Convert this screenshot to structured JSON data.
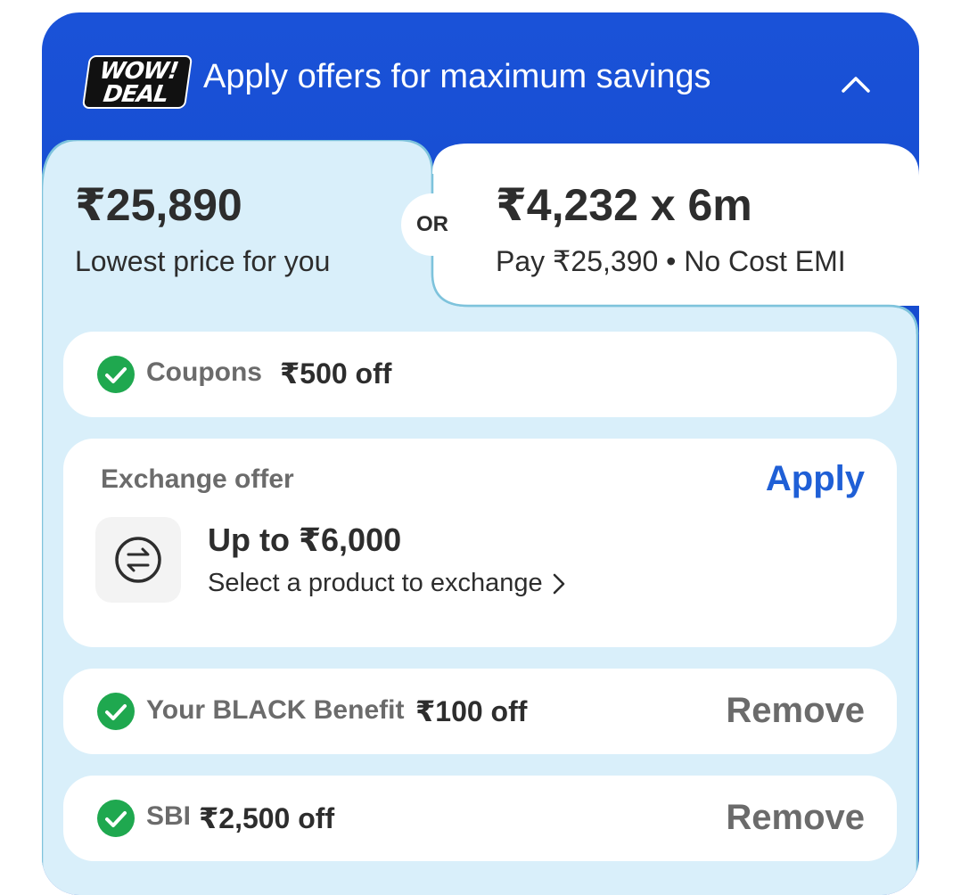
{
  "header": {
    "logo_line1": "WOW!",
    "logo_line2": "DEAL",
    "title": "Apply offers for maximum savings"
  },
  "pricing": {
    "lowest_price": "₹25,890",
    "lowest_label": "Lowest price for you",
    "or_label": "OR",
    "emi_price": "₹4,232 x 6m",
    "emi_label": "Pay ₹25,390 • No Cost EMI"
  },
  "offers": {
    "coupons": {
      "label": "Coupons",
      "value": "₹500 off"
    },
    "exchange": {
      "label": "Exchange offer",
      "action": "Apply",
      "title": "Up to ₹6,000",
      "subtitle": "Select a product to exchange"
    },
    "black_benefit": {
      "label": "Your BLACK Benefit",
      "value": "₹100 off",
      "action": "Remove"
    },
    "sbi": {
      "label": "SBI",
      "value": "₹2,500 off",
      "action": "Remove"
    }
  },
  "colors": {
    "header_blue": "#1a52d8",
    "panel_light_blue": "#d9effa",
    "panel_border": "#7ec3dc",
    "check_green": "#1fa84f",
    "apply_blue": "#1f5fd6",
    "text_dark": "#2d2d2d",
    "text_grey": "#6b6b6b"
  },
  "icons": {
    "collapse": "chevron-up-icon",
    "check": "check-circle-icon",
    "exchange": "exchange-arrows-icon",
    "chevron": "chevron-right-icon"
  }
}
